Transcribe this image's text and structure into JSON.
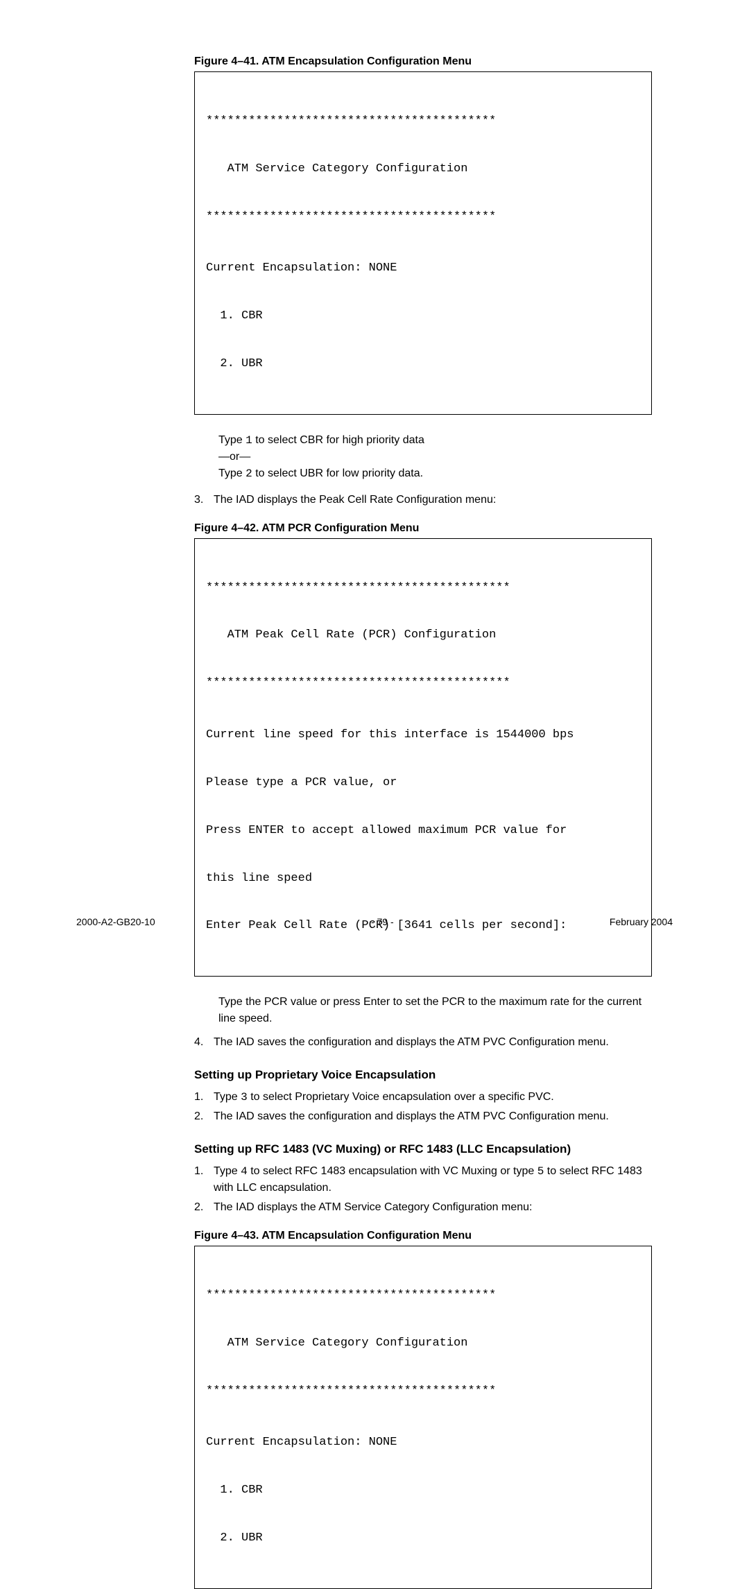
{
  "fig41": {
    "caption": "Figure 4–41.  ATM Encapsulation Configuration Menu",
    "line1": "*****************************************",
    "line2": "   ATM Service Category Configuration",
    "line3": "*****************************************",
    "line4": "Current Encapsulation: NONE",
    "line5": "  1. CBR",
    "line6": "  2. UBR"
  },
  "inst1": {
    "a_pre": "Type ",
    "a_code": "1",
    "a_post": " to select CBR for high priority data",
    "b": "—or—",
    "c_pre": "Type ",
    "c_code": "2",
    "c_post": " to select UBR for low priority data."
  },
  "step3": {
    "num": "3.",
    "text": "The IAD displays the Peak Cell Rate Configuration menu:"
  },
  "fig42": {
    "caption": "Figure 4–42.  ATM PCR Configuration Menu",
    "line1": "*******************************************",
    "line2": "   ATM Peak Cell Rate (PCR) Configuration",
    "line3": "*******************************************",
    "line4": "Current line speed for this interface is 1544000 bps",
    "line5": "Please type a PCR value, or",
    "line6": "Press ENTER to accept allowed maximum PCR value for",
    "line7": "this line speed",
    "line8": "Enter Peak Cell Rate (PCR) [3641 cells per second]:"
  },
  "inst2": {
    "text": "Type the PCR value or press Enter to set the PCR to the maximum rate for the current line speed."
  },
  "step4": {
    "num": "4.",
    "text": "The IAD saves the configuration and displays the ATM PVC Configuration menu."
  },
  "sectionA": {
    "heading": "Setting up Proprietary Voice Encapsulation",
    "item1_num": "1.",
    "item1_pre": "Type ",
    "item1_code": "3",
    "item1_post": " to select Proprietary Voice encapsulation over a specific PVC.",
    "item2_num": "2.",
    "item2_text": "The IAD saves the configuration and displays the ATM PVC Configuration menu."
  },
  "sectionB": {
    "heading": "Setting up RFC 1483 (VC Muxing) or RFC 1483 (LLC Encapsulation)",
    "item1_num": "1.",
    "item1_pre": "Type ",
    "item1_code1": "4",
    "item1_mid": " to select RFC 1483 encapsulation with VC Muxing or type ",
    "item1_code2": "5",
    "item1_post": " to select RFC 1483 with LLC encapsulation.",
    "item2_num": "2.",
    "item2_text": "The IAD displays the ATM Service Category Configuration menu:"
  },
  "fig43": {
    "caption": "Figure 4–43.  ATM Encapsulation Configuration Menu",
    "line1": "*****************************************",
    "line2": "   ATM Service Category Configuration",
    "line3": "*****************************************",
    "line4": "Current Encapsulation: NONE",
    "line5": "  1. CBR",
    "line6": "  2. UBR"
  },
  "footer": {
    "left": "2000-A2-GB20-10",
    "center": "- 79 -",
    "right": "February 2004"
  }
}
